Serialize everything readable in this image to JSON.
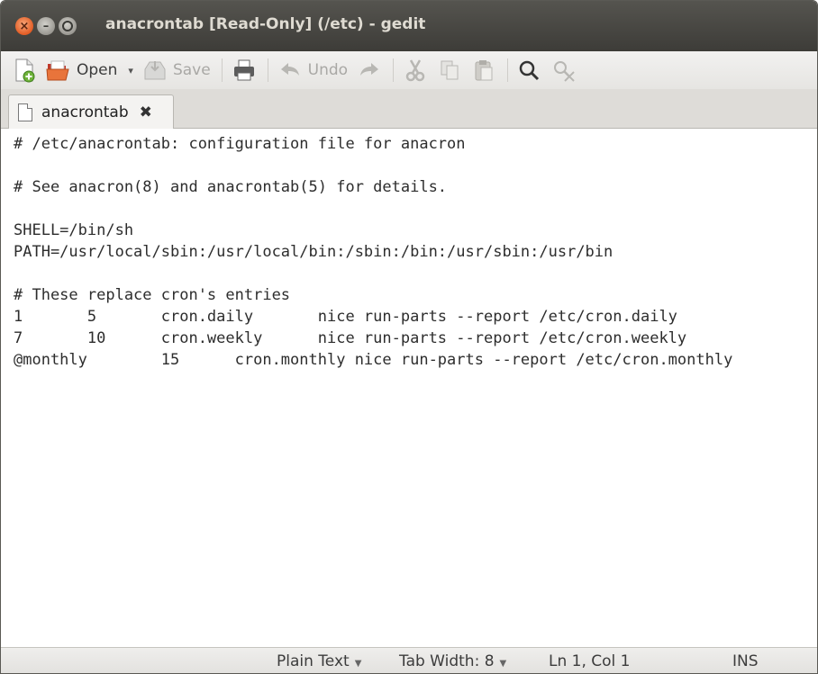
{
  "window": {
    "title": "anacrontab [Read-Only] (/etc) - gedit"
  },
  "toolbar": {
    "new_icon": "new-document-icon",
    "open_label": "Open",
    "open_dropdown": "▾",
    "save_label": "Save",
    "print_icon": "print-icon",
    "undo_label": "Undo",
    "redo_icon": "redo-icon",
    "cut_icon": "cut-icon",
    "copy_icon": "copy-icon",
    "paste_icon": "paste-icon",
    "find_icon": "search-icon",
    "replace_icon": "find-replace-icon"
  },
  "tabs": [
    {
      "label": "anacrontab",
      "close": "✖"
    }
  ],
  "editor": {
    "lines": [
      "# /etc/anacrontab: configuration file for anacron",
      "",
      "# See anacron(8) and anacrontab(5) for details.",
      "",
      "SHELL=/bin/sh",
      "PATH=/usr/local/sbin:/usr/local/bin:/sbin:/bin:/usr/sbin:/usr/bin",
      "",
      "# These replace cron's entries",
      "1       5       cron.daily       nice run-parts --report /etc/cron.daily",
      "7       10      cron.weekly      nice run-parts --report /etc/cron.weekly",
      "@monthly        15      cron.monthly nice run-parts --report /etc/cron.monthly"
    ]
  },
  "statusbar": {
    "language": "Plain Text",
    "tab_width": "Tab Width: 8",
    "position": "Ln 1, Col 1",
    "mode": "INS"
  },
  "colors": {
    "titlebar": "#3d3c38",
    "close_button": "#e35c24",
    "title_text": "#dfdbd2"
  }
}
